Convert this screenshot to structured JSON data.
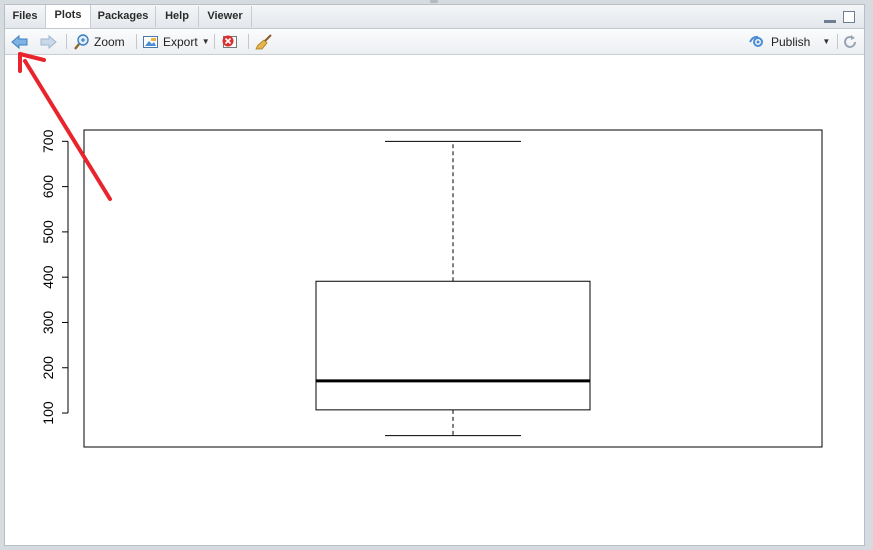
{
  "tabs": [
    {
      "label": "Files",
      "active": false
    },
    {
      "label": "Plots",
      "active": true
    },
    {
      "label": "Packages",
      "active": false
    },
    {
      "label": "Help",
      "active": false
    },
    {
      "label": "Viewer",
      "active": false
    }
  ],
  "toolbar": {
    "zoom_label": "Zoom",
    "export_label": "Export",
    "publish_label": "Publish",
    "icons": [
      "back-arrow-icon",
      "forward-arrow-icon",
      "zoom-icon",
      "export-icon",
      "remove-plot-icon",
      "broom-icon",
      "publish-icon",
      "refresh-icon"
    ]
  },
  "colors": {
    "accent_blue": "#4a8ed6",
    "annotation_red": "#e8242c"
  },
  "chart_data": {
    "type": "boxplot",
    "ylim": [
      25,
      725
    ],
    "yticks": [
      100,
      200,
      300,
      400,
      500,
      600,
      700
    ],
    "box": {
      "whisker_low": 50,
      "q1": 107,
      "median": 171,
      "q3": 391,
      "whisker_high": 700
    },
    "grid": false
  }
}
